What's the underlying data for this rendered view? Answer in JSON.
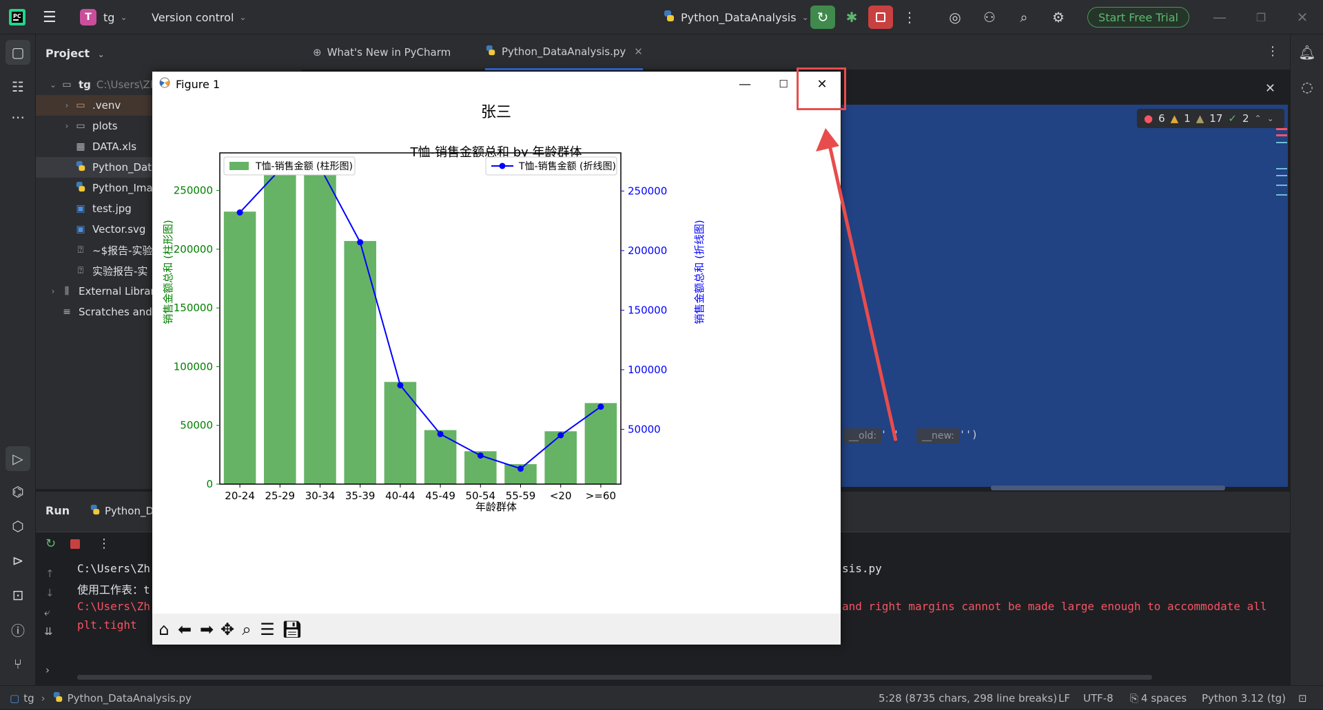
{
  "titlebar": {
    "project_badge": "T",
    "project_name": "tg",
    "version_control": "Version control",
    "run_config": "Python_DataAnalysis",
    "trial_button": "Start Free Trial"
  },
  "project_panel": {
    "title": "Project",
    "items": [
      {
        "label": "tg",
        "hint": "C:\\Users\\Zh",
        "icon": "folder-icon"
      },
      {
        "label": ".venv",
        "icon": "folder-icon"
      },
      {
        "label": "plots",
        "icon": "folder-icon"
      },
      {
        "label": "DATA.xls",
        "icon": "table-icon"
      },
      {
        "label": "Python_Dat",
        "icon": "python-icon"
      },
      {
        "label": "Python_Ima",
        "icon": "python-icon"
      },
      {
        "label": "test.jpg",
        "icon": "image-icon"
      },
      {
        "label": "Vector.svg",
        "icon": "image-icon"
      },
      {
        "label": "~$报告-实验",
        "icon": "unknown-file-icon"
      },
      {
        "label": "实验报告-实",
        "icon": "unknown-file-icon"
      },
      {
        "label": "External Librar",
        "icon": "library-icon"
      },
      {
        "label": "Scratches and",
        "icon": "scratch-icon"
      }
    ]
  },
  "tabs": [
    {
      "label": "What's New in PyCharm",
      "icon": "globe-icon"
    },
    {
      "label": "Python_DataAnalysis.py",
      "icon": "python-icon"
    }
  ],
  "inspections": {
    "errors": "6",
    "warnings": "1",
    "weak_warnings": "17",
    "typos": "2"
  },
  "editor_hints": {
    "old": "__old:",
    "old_val": "' '",
    "new": "__new:",
    "new_val": "'')"
  },
  "run_panel": {
    "title": "Run",
    "tab": "Python_D",
    "lines": [
      {
        "text": "C:\\Users\\Zh",
        "tail": "sis.py",
        "color": "#dfe1e5"
      },
      {
        "text": "使用工作表：t",
        "tail": "",
        "color": "#dfe1e5"
      },
      {
        "text": "C:\\Users\\Zh",
        "tail": "and right margins cannot be made large enough to accommodate all",
        "color": "#f75464"
      },
      {
        "text": "  plt.tight",
        "tail": "",
        "color": "#f75464"
      }
    ]
  },
  "statusbar": {
    "project": "tg",
    "file": "Python_DataAnalysis.py",
    "position": "5:28 (8735 chars, 298 line breaks)",
    "line_sep": "LF",
    "encoding": "UTF-8",
    "indent": "4 spaces",
    "interpreter": "Python 3.12 (tg)"
  },
  "figure": {
    "window_title": "Figure 1",
    "suptitle": "张三",
    "accent_close_highlight": "#e84c4c"
  },
  "chart_data": {
    "type": "bar",
    "title": "T恤-销售金额总和 by 年龄群体",
    "xlabel": "年龄群体",
    "ylabel_left": "销售金额总和 (柱形图)",
    "ylabel_right": "销售金额总和 (折线图)",
    "categories": [
      "20-24",
      "25-29",
      "30-34",
      "35-39",
      "40-44",
      "45-49",
      "50-54",
      "55-59",
      "<20",
      ">=60"
    ],
    "series": [
      {
        "name": "T恤-销售金额 (柱形图)",
        "kind": "bar",
        "axis": "left",
        "color": "#66b366",
        "values": [
          232000,
          268000,
          270000,
          207000,
          87000,
          46000,
          28000,
          17000,
          45000,
          69000
        ]
      },
      {
        "name": "T恤-销售金额 (折线图)",
        "kind": "line",
        "axis": "right",
        "color": "#0000ff",
        "values": [
          232000,
          268000,
          270000,
          207000,
          87000,
          46000,
          28000,
          17000,
          45000,
          69000
        ]
      }
    ],
    "ylim_left": [
      0,
      282000
    ],
    "left_ticks": [
      "0",
      "50000",
      "100000",
      "150000",
      "200000",
      "250000"
    ],
    "ylim_right": [
      4000,
      282000
    ],
    "right_ticks": [
      "50000",
      "100000",
      "150000",
      "200000",
      "250000"
    ],
    "legend": [
      "top-left",
      "top-right"
    ],
    "grid": false
  }
}
